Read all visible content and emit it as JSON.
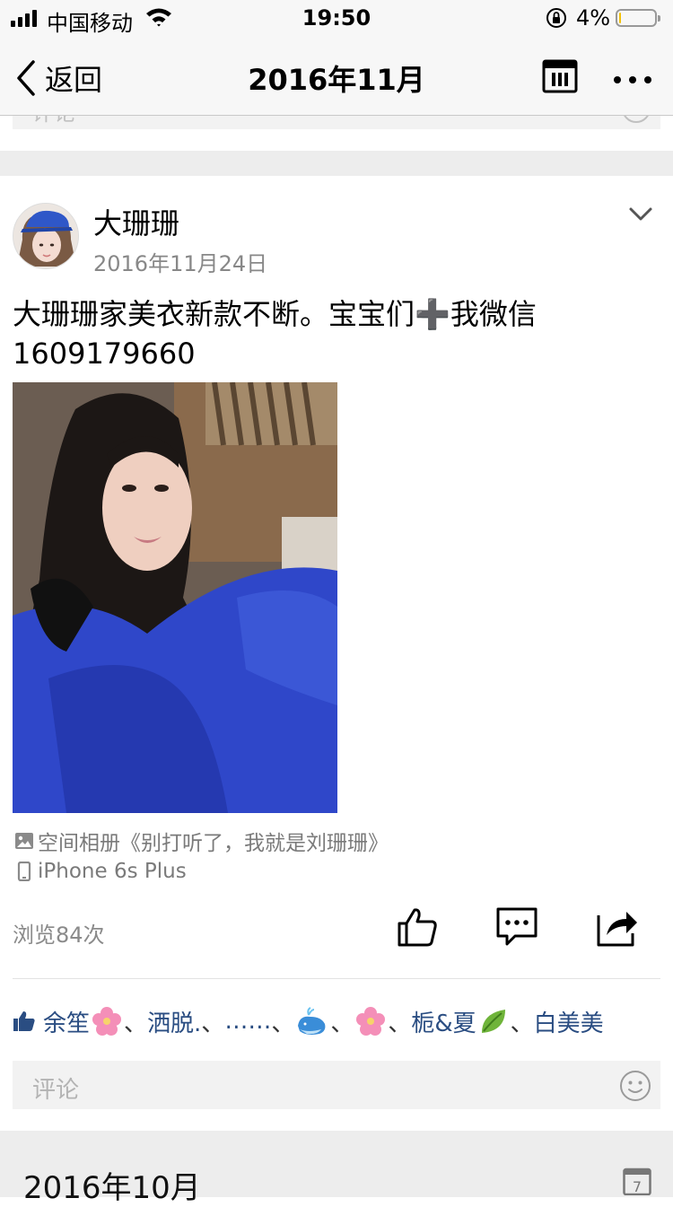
{
  "status_bar": {
    "carrier": "中国移动",
    "time": "19:50",
    "battery_percent": "4%"
  },
  "nav": {
    "back_label": "返回",
    "title": "2016年11月",
    "icons": [
      "chevron-left-icon",
      "calendar-icon",
      "more-icon"
    ]
  },
  "previous_card": {
    "comment_placeholder": "评论"
  },
  "post": {
    "author": "大珊珊",
    "date": "2016年11月24日",
    "text_line1": "大珊珊家美衣新款不断。宝宝们➕我微信",
    "text_line2": "1609179660",
    "album": "空间相册《别打听了，我就是刘珊珊》",
    "device": "iPhone 6s Plus",
    "views": "浏览84次",
    "actions": [
      "like-icon",
      "comment-icon",
      "share-icon"
    ],
    "likes": {
      "names": [
        "余笙",
        "洒脱.",
        "……",
        "",
        "",
        "栀&夏",
        "白美美"
      ],
      "separator": "、"
    },
    "comment_placeholder": "评论"
  },
  "next_month": {
    "label": "2016年10月",
    "calendar_day": "7"
  },
  "colors": {
    "link_blue": "#2a4d82",
    "page_bg": "#ffffff",
    "band_gray": "#ededed",
    "nav_bg": "#f7f7f7"
  }
}
